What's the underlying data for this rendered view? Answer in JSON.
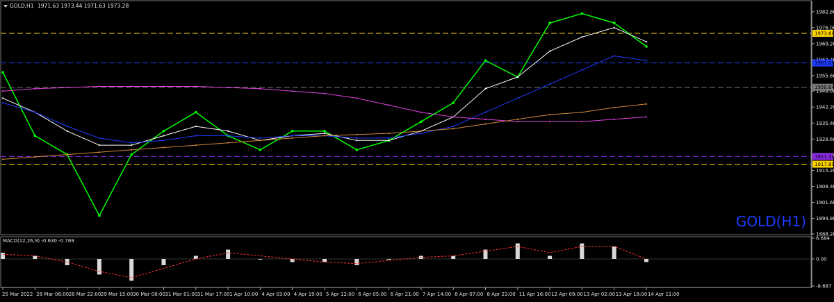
{
  "header": {
    "symbol": "GOLD,H1",
    "ohlc": "1971.63 1973.44 1971.63 1973.28"
  },
  "watermark": "GOLD(H1)",
  "macd": {
    "label": "MACD(12,26,9) -0.630 -0.769",
    "axis_ticks": [
      "6.684",
      "0.00",
      "-8.687"
    ]
  },
  "price_axis": {
    "ticks": [
      "1982.80",
      "1976.00",
      "1969.20",
      "1962.40",
      "1955.60",
      "1949.00",
      "1942.20",
      "1935.40",
      "1928.60",
      "1921.80",
      "1915.20",
      "1908.40",
      "1901.60",
      "1894.80",
      "1888.20"
    ],
    "labels": [
      {
        "text": "1973.60",
        "color": "#ffd400"
      },
      {
        "text": "1961.00",
        "color": "#1e3cff"
      },
      {
        "text": "1950.64",
        "color": "#7a7a7a"
      },
      {
        "text": "1921.20",
        "color": "#8a2be2"
      },
      {
        "text": "1917.89",
        "color": "#ffd400"
      }
    ]
  },
  "time_axis": [
    "25 Mar 2022",
    "28 Mar 06:00",
    "28 Mar 22:00",
    "29 Mar 15:00",
    "30 Mar 08:00",
    "31 Mar 01:00",
    "31 Mar 17:00",
    "1 Apr 10:00",
    "4 Apr 03:00",
    "4 Apr 19:00",
    "5 Apr 12:00",
    "6 Apr 05:00",
    "6 Apr 21:00",
    "7 Apr 14:00",
    "8 Apr 07:00",
    "8 Apr 23:00",
    "11 Apr 16:00",
    "12 Apr 09:00",
    "13 Apr 02:00",
    "13 Apr 18:00",
    "14 Apr 11:00"
  ],
  "chart_data": {
    "type": "line",
    "symbol": "GOLD",
    "timeframe": "H1",
    "ylim": [
      1888.2,
      1986.0
    ],
    "grid": false,
    "x": [
      "25 Mar 2022",
      "28 Mar 06:00",
      "28 Mar 22:00",
      "29 Mar 15:00",
      "30 Mar 08:00",
      "31 Mar 01:00",
      "31 Mar 17:00",
      "1 Apr 10:00",
      "4 Apr 03:00",
      "4 Apr 19:00",
      "5 Apr 12:00",
      "6 Apr 05:00",
      "6 Apr 21:00",
      "7 Apr 14:00",
      "8 Apr 07:00",
      "8 Apr 23:00",
      "11 Apr 16:00",
      "12 Apr 09:00",
      "13 Apr 02:00",
      "13 Apr 18:00",
      "14 Apr 11:00"
    ],
    "series": [
      {
        "values": [
          1957,
          1930,
          1922,
          1896,
          1922,
          1932,
          1940,
          1930,
          1924,
          1932,
          1932,
          1924,
          1928,
          1936,
          1944,
          1962,
          1955,
          1978,
          1982,
          1978,
          1968
        ],
        "color": "#00ff00"
      },
      {
        "values": [
          1946,
          1940,
          1932,
          1926,
          1926,
          1930,
          1934,
          1932,
          1928,
          1930,
          1931,
          1928,
          1928,
          1932,
          1938,
          1950,
          1955,
          1966,
          1972,
          1976,
          1970
        ],
        "color": "#ffffff"
      },
      {
        "values": [
          1944,
          1940,
          1934,
          1929,
          1927,
          1928,
          1930,
          1930,
          1929,
          1930,
          1930,
          1929,
          1929,
          1931,
          1934,
          1940,
          1946,
          1952,
          1958,
          1964,
          1962
        ],
        "color": "#1e3cff"
      },
      {
        "values": [
          1949,
          1950,
          1950.5,
          1951,
          1951,
          1951,
          1951,
          1950.5,
          1950,
          1949,
          1948,
          1946,
          1943,
          1940,
          1938,
          1937,
          1936,
          1936,
          1936,
          1937,
          1938
        ],
        "color": "#e040e0"
      },
      {
        "values": [
          1920,
          1921,
          1922,
          1923,
          1924,
          1925,
          1926,
          1927,
          1928,
          1929,
          1930,
          1930.5,
          1931,
          1932,
          1933,
          1935,
          1937,
          1939,
          1940,
          1942,
          1943.5
        ],
        "color": "#d2873c"
      }
    ],
    "hlines": [
      {
        "y": 1973.6,
        "color": "#ffd400"
      },
      {
        "y": 1961.0,
        "color": "#1e3cff"
      },
      {
        "y": 1950.64,
        "color": "#7a7a7a"
      },
      {
        "y": 1921.2,
        "color": "#8a2be2"
      },
      {
        "y": 1917.89,
        "color": "#ffd400"
      }
    ],
    "macd": {
      "ylim": [
        -8.687,
        6.684
      ],
      "histogram": [
        2,
        1,
        -2,
        -5,
        -7,
        -2,
        1,
        3,
        0,
        -1,
        -1,
        -2,
        0,
        1,
        1,
        3,
        5,
        1,
        5,
        4,
        -1
      ],
      "signal": [
        1.5,
        1,
        -1,
        -4,
        -6,
        -3,
        0,
        2,
        1,
        0,
        -1,
        -1.5,
        -0.5,
        0.5,
        1,
        2.5,
        4,
        2,
        4,
        4,
        0
      ]
    }
  }
}
